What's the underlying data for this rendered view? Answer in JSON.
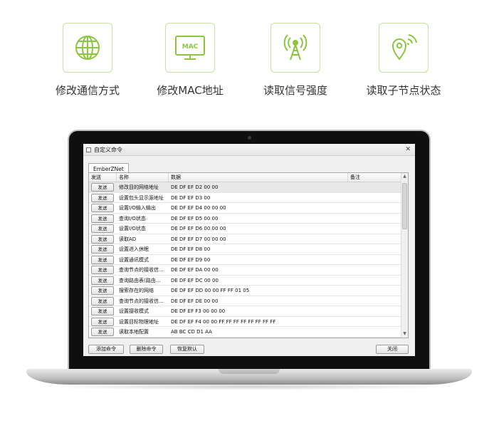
{
  "features": [
    {
      "icon": "globe-icon",
      "label": "修改通信方式"
    },
    {
      "icon": "mac-icon",
      "label": "修改MAC地址",
      "icon_text": "MAC"
    },
    {
      "icon": "signal-tower-icon",
      "label": "读取信号强度"
    },
    {
      "icon": "location-signal-icon",
      "label": "读取子节点状态"
    }
  ],
  "colors": {
    "accent": "#8cc63f"
  },
  "window": {
    "title": "自定义命令",
    "close": "✕",
    "tab": "EmberZNet",
    "columns": {
      "send": "发送",
      "name": "名称",
      "data": "数据",
      "note": "备注"
    },
    "send_label": "发送",
    "rows": [
      {
        "name": "修改目的网络地址",
        "data": "DE DF EF D2 00 00",
        "note": ""
      },
      {
        "name": "设置包头显示源地址",
        "data": "DE DF EF D3 00",
        "note": ""
      },
      {
        "name": "设置I/O输入输出",
        "data": "DE DF EF D4 00 00 00",
        "note": ""
      },
      {
        "name": "查询I/O状态",
        "data": "DE DF EF D5 00 00",
        "note": ""
      },
      {
        "name": "设置I/O状态",
        "data": "DE DF EF D6 00 00 00",
        "note": ""
      },
      {
        "name": "读取AD",
        "data": "DE DF EF D7 00 00 00",
        "note": ""
      },
      {
        "name": "设置进入休眠",
        "data": "DE DF EF D8 00",
        "note": ""
      },
      {
        "name": "设置通讯模式",
        "data": "DE DF EF D9 00",
        "note": ""
      },
      {
        "name": "查询节点的接收信...",
        "data": "DE DF EF DA 00 00",
        "note": ""
      },
      {
        "name": "查询路由表(路由...",
        "data": "DE DF EF DC 00 00",
        "note": ""
      },
      {
        "name": "搜索存在的网络",
        "data": "DE DF EF DD 00 00 FF FF 01 05",
        "note": ""
      },
      {
        "name": "查询节点的接收信...",
        "data": "DE DF EF DE 00 00",
        "note": ""
      },
      {
        "name": "设置接收模式",
        "data": "DE DF EF F3 00 00 00",
        "note": ""
      },
      {
        "name": "设置目标物理地址",
        "data": "DE DF EF F4 00 00 FF FF FF FF FF FF FF FF",
        "note": ""
      },
      {
        "name": "读取本地配置",
        "data": "AB BC CD D1 AA",
        "note": ""
      }
    ],
    "footer": {
      "add": "添加命令",
      "delete": "删除命令",
      "restore": "恢复默认",
      "close": "关闭"
    }
  }
}
